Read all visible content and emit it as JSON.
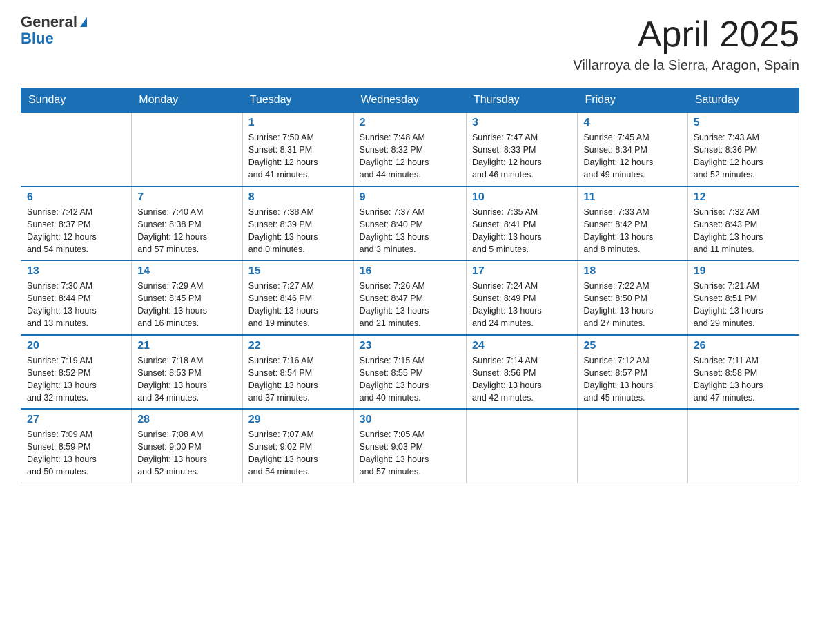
{
  "header": {
    "logo_general": "General",
    "logo_blue": "Blue",
    "month": "April 2025",
    "location": "Villarroya de la Sierra, Aragon, Spain"
  },
  "days_of_week": [
    "Sunday",
    "Monday",
    "Tuesday",
    "Wednesday",
    "Thursday",
    "Friday",
    "Saturday"
  ],
  "weeks": [
    [
      {
        "day": "",
        "info": ""
      },
      {
        "day": "",
        "info": ""
      },
      {
        "day": "1",
        "info": "Sunrise: 7:50 AM\nSunset: 8:31 PM\nDaylight: 12 hours\nand 41 minutes."
      },
      {
        "day": "2",
        "info": "Sunrise: 7:48 AM\nSunset: 8:32 PM\nDaylight: 12 hours\nand 44 minutes."
      },
      {
        "day": "3",
        "info": "Sunrise: 7:47 AM\nSunset: 8:33 PM\nDaylight: 12 hours\nand 46 minutes."
      },
      {
        "day": "4",
        "info": "Sunrise: 7:45 AM\nSunset: 8:34 PM\nDaylight: 12 hours\nand 49 minutes."
      },
      {
        "day": "5",
        "info": "Sunrise: 7:43 AM\nSunset: 8:36 PM\nDaylight: 12 hours\nand 52 minutes."
      }
    ],
    [
      {
        "day": "6",
        "info": "Sunrise: 7:42 AM\nSunset: 8:37 PM\nDaylight: 12 hours\nand 54 minutes."
      },
      {
        "day": "7",
        "info": "Sunrise: 7:40 AM\nSunset: 8:38 PM\nDaylight: 12 hours\nand 57 minutes."
      },
      {
        "day": "8",
        "info": "Sunrise: 7:38 AM\nSunset: 8:39 PM\nDaylight: 13 hours\nand 0 minutes."
      },
      {
        "day": "9",
        "info": "Sunrise: 7:37 AM\nSunset: 8:40 PM\nDaylight: 13 hours\nand 3 minutes."
      },
      {
        "day": "10",
        "info": "Sunrise: 7:35 AM\nSunset: 8:41 PM\nDaylight: 13 hours\nand 5 minutes."
      },
      {
        "day": "11",
        "info": "Sunrise: 7:33 AM\nSunset: 8:42 PM\nDaylight: 13 hours\nand 8 minutes."
      },
      {
        "day": "12",
        "info": "Sunrise: 7:32 AM\nSunset: 8:43 PM\nDaylight: 13 hours\nand 11 minutes."
      }
    ],
    [
      {
        "day": "13",
        "info": "Sunrise: 7:30 AM\nSunset: 8:44 PM\nDaylight: 13 hours\nand 13 minutes."
      },
      {
        "day": "14",
        "info": "Sunrise: 7:29 AM\nSunset: 8:45 PM\nDaylight: 13 hours\nand 16 minutes."
      },
      {
        "day": "15",
        "info": "Sunrise: 7:27 AM\nSunset: 8:46 PM\nDaylight: 13 hours\nand 19 minutes."
      },
      {
        "day": "16",
        "info": "Sunrise: 7:26 AM\nSunset: 8:47 PM\nDaylight: 13 hours\nand 21 minutes."
      },
      {
        "day": "17",
        "info": "Sunrise: 7:24 AM\nSunset: 8:49 PM\nDaylight: 13 hours\nand 24 minutes."
      },
      {
        "day": "18",
        "info": "Sunrise: 7:22 AM\nSunset: 8:50 PM\nDaylight: 13 hours\nand 27 minutes."
      },
      {
        "day": "19",
        "info": "Sunrise: 7:21 AM\nSunset: 8:51 PM\nDaylight: 13 hours\nand 29 minutes."
      }
    ],
    [
      {
        "day": "20",
        "info": "Sunrise: 7:19 AM\nSunset: 8:52 PM\nDaylight: 13 hours\nand 32 minutes."
      },
      {
        "day": "21",
        "info": "Sunrise: 7:18 AM\nSunset: 8:53 PM\nDaylight: 13 hours\nand 34 minutes."
      },
      {
        "day": "22",
        "info": "Sunrise: 7:16 AM\nSunset: 8:54 PM\nDaylight: 13 hours\nand 37 minutes."
      },
      {
        "day": "23",
        "info": "Sunrise: 7:15 AM\nSunset: 8:55 PM\nDaylight: 13 hours\nand 40 minutes."
      },
      {
        "day": "24",
        "info": "Sunrise: 7:14 AM\nSunset: 8:56 PM\nDaylight: 13 hours\nand 42 minutes."
      },
      {
        "day": "25",
        "info": "Sunrise: 7:12 AM\nSunset: 8:57 PM\nDaylight: 13 hours\nand 45 minutes."
      },
      {
        "day": "26",
        "info": "Sunrise: 7:11 AM\nSunset: 8:58 PM\nDaylight: 13 hours\nand 47 minutes."
      }
    ],
    [
      {
        "day": "27",
        "info": "Sunrise: 7:09 AM\nSunset: 8:59 PM\nDaylight: 13 hours\nand 50 minutes."
      },
      {
        "day": "28",
        "info": "Sunrise: 7:08 AM\nSunset: 9:00 PM\nDaylight: 13 hours\nand 52 minutes."
      },
      {
        "day": "29",
        "info": "Sunrise: 7:07 AM\nSunset: 9:02 PM\nDaylight: 13 hours\nand 54 minutes."
      },
      {
        "day": "30",
        "info": "Sunrise: 7:05 AM\nSunset: 9:03 PM\nDaylight: 13 hours\nand 57 minutes."
      },
      {
        "day": "",
        "info": ""
      },
      {
        "day": "",
        "info": ""
      },
      {
        "day": "",
        "info": ""
      }
    ]
  ]
}
